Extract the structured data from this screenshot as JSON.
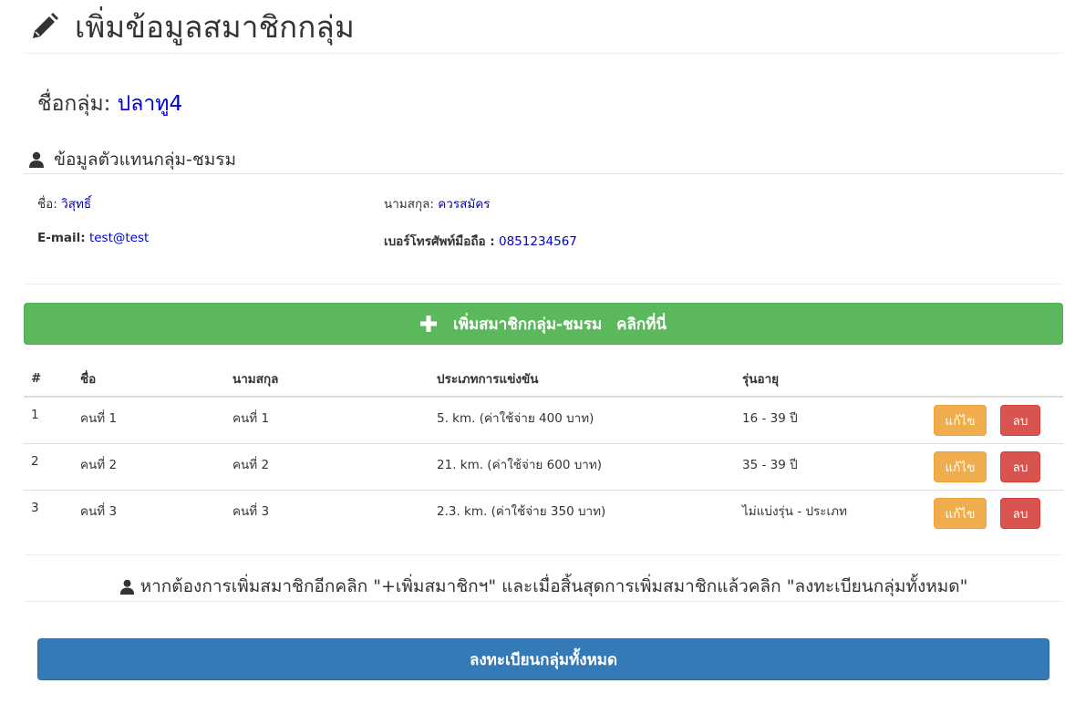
{
  "page": {
    "title": "เพิ่มข้อมูลสมาชิกกลุ่ม",
    "title_icon": "pencil-icon"
  },
  "group": {
    "label": "ชื่อกลุ่ม:",
    "name": "ปลาทู4"
  },
  "representative": {
    "heading": "ข้อมูลตัวแทนกลุ่ม-ชมรม",
    "heading_icon": "user-icon",
    "first_name_label": "ชื่อ:",
    "first_name": "วิสุทธิ์",
    "last_name_label": "นามสกุล:",
    "last_name": "ควรสมัคร",
    "email_label": "E-mail:",
    "email": "test@test",
    "phone_label": "เบอร์โทรศัพท์มือถือ :",
    "phone": "0851234567"
  },
  "add_button": {
    "label": "เพิ่มสมาชิกกลุ่ม-ชมรม คลิกที่นี่",
    "icon": "plus-icon",
    "color": "#5cb85c"
  },
  "table": {
    "columns": [
      "#",
      "ชื่อ",
      "นามสกุล",
      "ประเภทการแข่งขัน",
      "รุ่นอายุ"
    ],
    "rows": [
      {
        "no": "1",
        "first": "คนที่ 1",
        "last": "คนที่ 1",
        "type": "5. km. (ค่าใช้จ่าย 400 บาท)",
        "age": "16 - 39 ปี"
      },
      {
        "no": "2",
        "first": "คนที่ 2",
        "last": "คนที่ 2",
        "type": "21. km. (ค่าใช้จ่าย 600 บาท)",
        "age": "35 - 39 ปี"
      },
      {
        "no": "3",
        "first": "คนที่ 3",
        "last": "คนที่ 3",
        "type": "2.3. km. (ค่าใช้จ่าย 350 บาท)",
        "age": "ไม่แบ่งรุ่น - ประเภท"
      }
    ],
    "edit_label": "แก้ไข",
    "delete_label": "ลบ",
    "edit_color": "#f0ad4e",
    "delete_color": "#d9534f"
  },
  "notice": {
    "text": "หากต้องการเพิ่มสมาชิกอีกคลิก \"+เพิ่มสมาชิกฯ\" และเมื่อสิ้นสุดการเพิ่มสมาชิกแล้วคลิก \"ลงทะเบียนกลุ่มทั้งหมด\"",
    "icon": "user-icon"
  },
  "submit_button": {
    "label": "ลงทะเบียนกลุ่มทั้งหมด",
    "color": "#337ab7"
  }
}
